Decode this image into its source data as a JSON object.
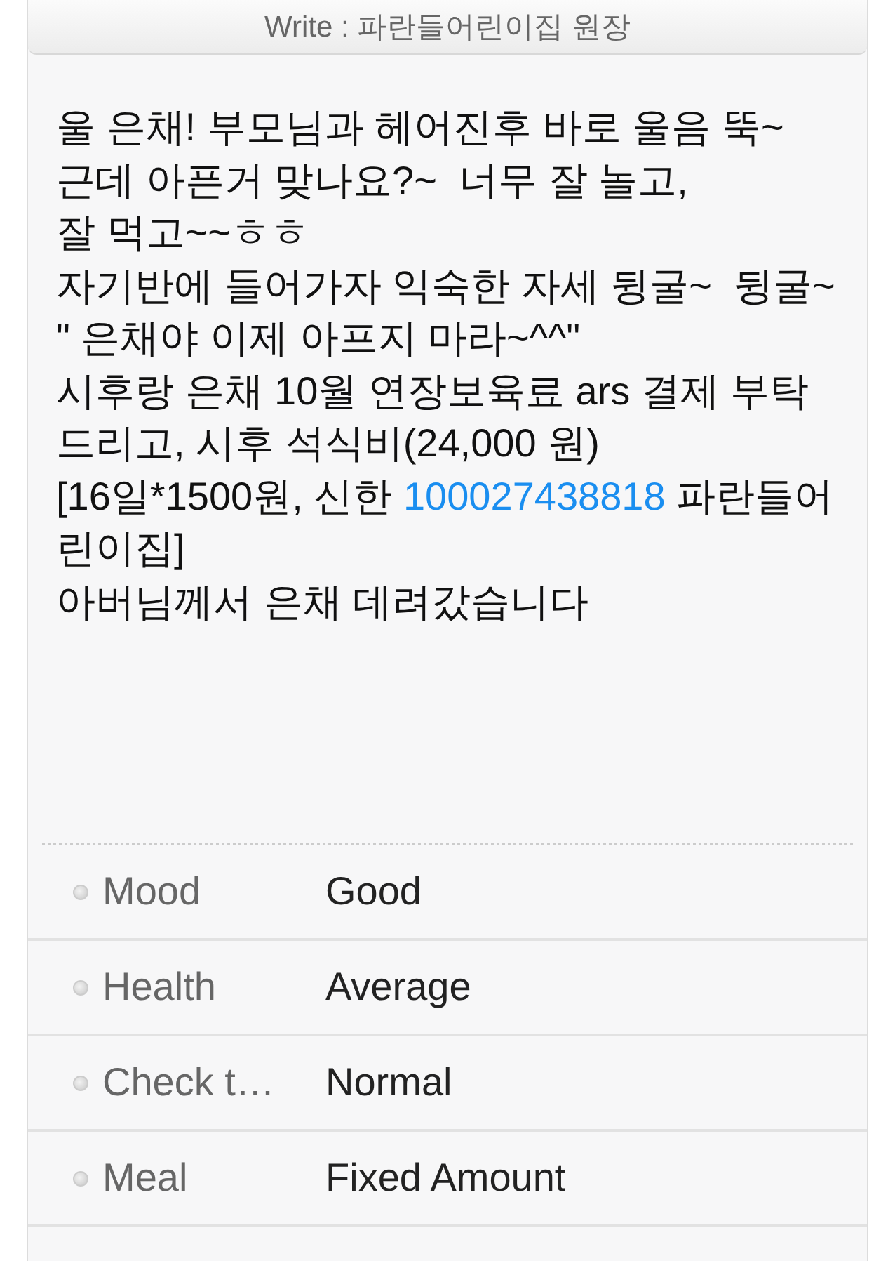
{
  "window": {
    "title": "Write : 파란들어린이집 원장"
  },
  "message": {
    "paragraphs": [
      {
        "text": "울 은채! 부모님과 헤어진후 바로 울음 뚝~"
      },
      {
        "text": "근데 아픈거 맞나요?~  너무 잘 놀고,"
      },
      {
        "text": "잘 먹고~~ㅎㅎ"
      },
      {
        "text": "자기반에 들어가자 익숙한 자세 뒹굴~  뒹굴~"
      },
      {
        "text": "\" 은채야 이제 아프지 마라~^^\""
      },
      {
        "text": "시후랑 은채 10월 연장보육료 ars 결제 부탁드리고, 시후 석식비(24,000 원)"
      },
      {
        "text": "[16일*1500원, 신한 ",
        "link": "100027438818",
        "after": " 파란들어린이집]"
      },
      {
        "text": "아버님께서 은채 데려갔습니다"
      }
    ]
  },
  "fields": [
    {
      "label": "Mood",
      "value": "Good"
    },
    {
      "label": "Health",
      "value": "Average"
    },
    {
      "label": "Check t…",
      "value": "Normal"
    },
    {
      "label": "Meal",
      "value": "Fixed Amount"
    }
  ]
}
